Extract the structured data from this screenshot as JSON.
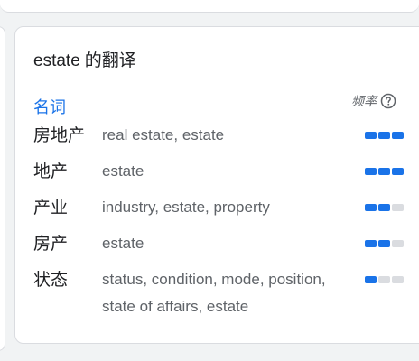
{
  "translation_card": {
    "word": "estate",
    "title_suffix": "的翻译",
    "part_of_speech": "名词",
    "frequency_label": "频率",
    "help_icon": "help-circle-icon",
    "rows": [
      {
        "term": "房地产",
        "translations": "real estate, estate",
        "frequency": 3
      },
      {
        "term": "地产",
        "translations": "estate",
        "frequency": 3
      },
      {
        "term": "产业",
        "translations": "industry, estate, property",
        "frequency": 2
      },
      {
        "term": "房产",
        "translations": "estate",
        "frequency": 2
      },
      {
        "term": "状态",
        "translations": "status, condition, mode, position, state of affairs, estate",
        "frequency": 1
      }
    ]
  },
  "colors": {
    "accent": "#1a73e8",
    "bar_inactive": "#dadce0",
    "text_primary": "#202124",
    "text_secondary": "#5f6368"
  }
}
